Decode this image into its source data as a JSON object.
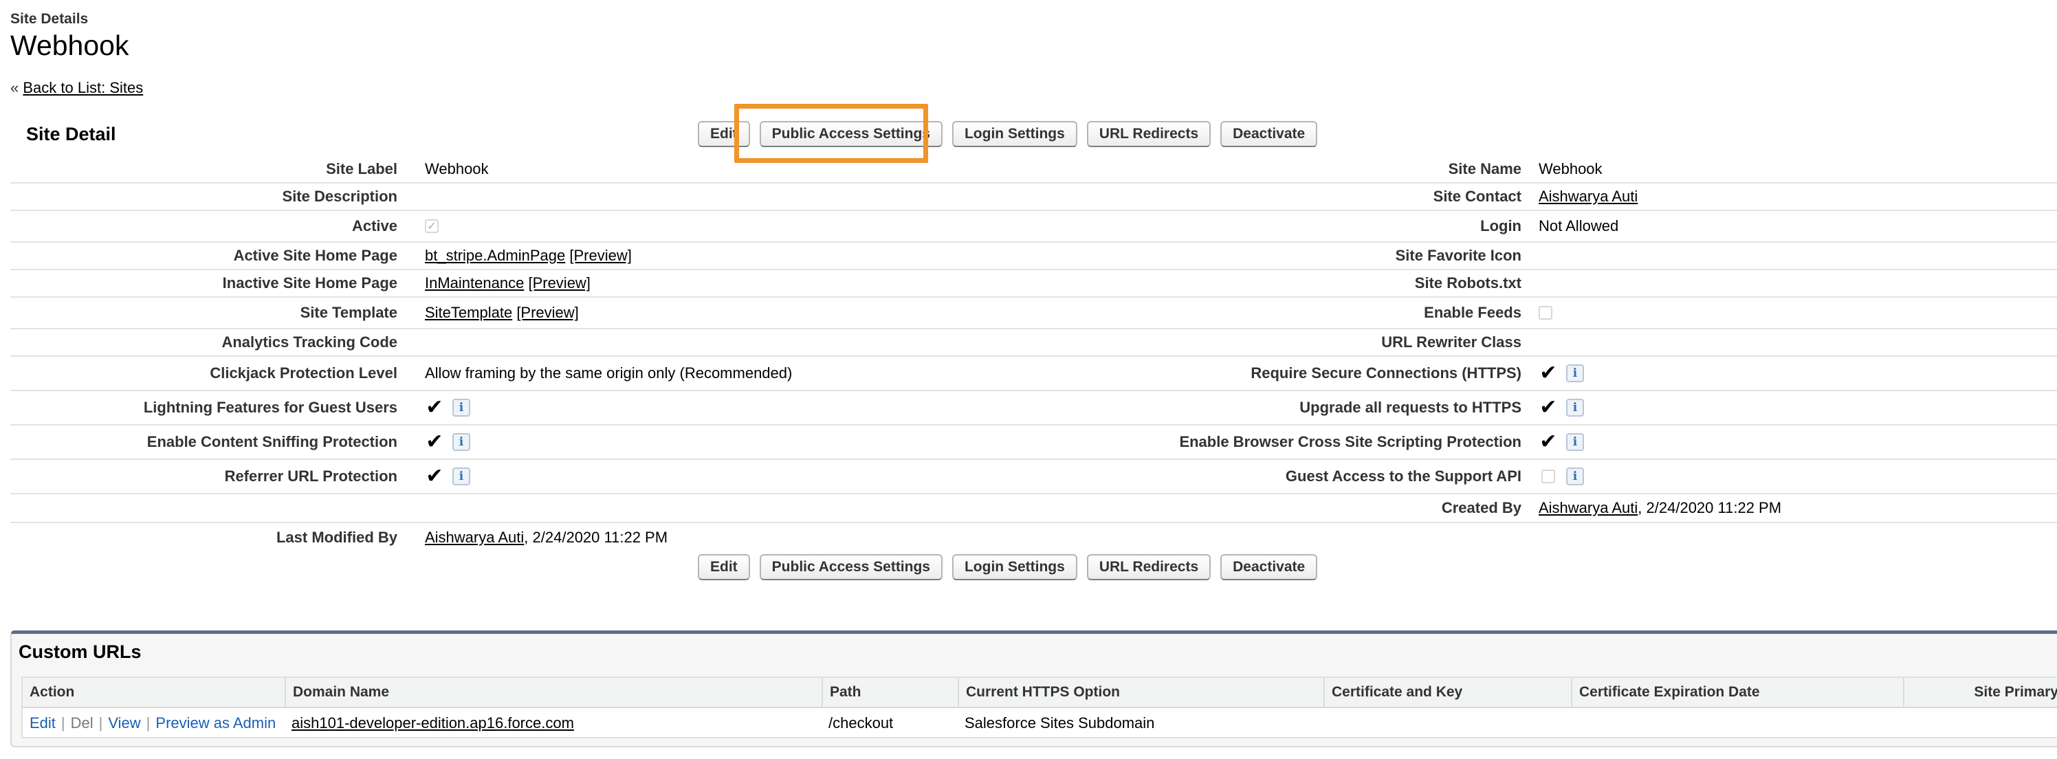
{
  "header": {
    "subtitle": "Site Details",
    "title": "Webhook"
  },
  "breadcrumb": {
    "prefix": "«",
    "link": "Back to List: Sites"
  },
  "section_title": "Site Detail",
  "buttons": {
    "edit": "Edit",
    "public_access": "Public Access Settings",
    "login_settings": "Login Settings",
    "url_redirects": "URL Redirects",
    "deactivate": "Deactivate"
  },
  "fields": {
    "site_label": {
      "label": "Site Label",
      "value": "Webhook"
    },
    "site_name": {
      "label": "Site Name",
      "value": "Webhook"
    },
    "site_description": {
      "label": "Site Description",
      "value": ""
    },
    "site_contact": {
      "label": "Site Contact",
      "value": "Aishwarya Auti"
    },
    "active": {
      "label": "Active",
      "checked": true
    },
    "login": {
      "label": "Login",
      "value": "Not Allowed"
    },
    "active_home": {
      "label": "Active Site Home Page",
      "link": "bt_stripe.AdminPage",
      "preview": "[Preview]"
    },
    "favorite_icon": {
      "label": "Site Favorite Icon",
      "value": ""
    },
    "inactive_home": {
      "label": "Inactive Site Home Page",
      "link": "InMaintenance",
      "preview": "[Preview]"
    },
    "robots": {
      "label": "Site Robots.txt",
      "value": ""
    },
    "template": {
      "label": "Site Template",
      "link": "SiteTemplate",
      "preview": "[Preview]"
    },
    "enable_feeds": {
      "label": "Enable Feeds",
      "checked": false
    },
    "analytics": {
      "label": "Analytics Tracking Code",
      "value": ""
    },
    "url_rewriter": {
      "label": "URL Rewriter Class",
      "value": ""
    },
    "clickjack": {
      "label": "Clickjack Protection Level",
      "value": "Allow framing by the same origin only (Recommended)"
    },
    "secure_conn": {
      "label": "Require Secure Connections (HTTPS)",
      "checked": true
    },
    "lightning_guest": {
      "label": "Lightning Features for Guest Users",
      "checked": true
    },
    "upgrade_https": {
      "label": "Upgrade all requests to HTTPS",
      "checked": true
    },
    "content_sniffing": {
      "label": "Enable Content Sniffing Protection",
      "checked": true
    },
    "xss": {
      "label": "Enable Browser Cross Site Scripting Protection",
      "checked": true
    },
    "referrer": {
      "label": "Referrer URL Protection",
      "checked": true
    },
    "guest_support": {
      "label": "Guest Access to the Support API",
      "checked": false
    },
    "created_by": {
      "label": "Created By",
      "user": "Aishwarya Auti",
      "date": ", 2/24/2020 11:22 PM"
    },
    "modified_by": {
      "label": "Last Modified By",
      "user": "Aishwarya Auti",
      "date": ", 2/24/2020 11:22 PM"
    }
  },
  "icons": {
    "check": "✓",
    "checkmark": "✔",
    "info": "i"
  },
  "custom_urls": {
    "title": "Custom URLs",
    "columns": [
      "Action",
      "Domain Name",
      "Path",
      "Current HTTPS Option",
      "Certificate and Key",
      "Certificate Expiration Date",
      "Site Primary"
    ],
    "row": {
      "edit": "Edit",
      "del": "Del",
      "view": "View",
      "preview": "Preview as Admin",
      "sep": "|",
      "domain": "aish101-developer-edition.ap16.force.com",
      "path": "/checkout",
      "https_option": "Salesforce Sites Subdomain"
    }
  }
}
